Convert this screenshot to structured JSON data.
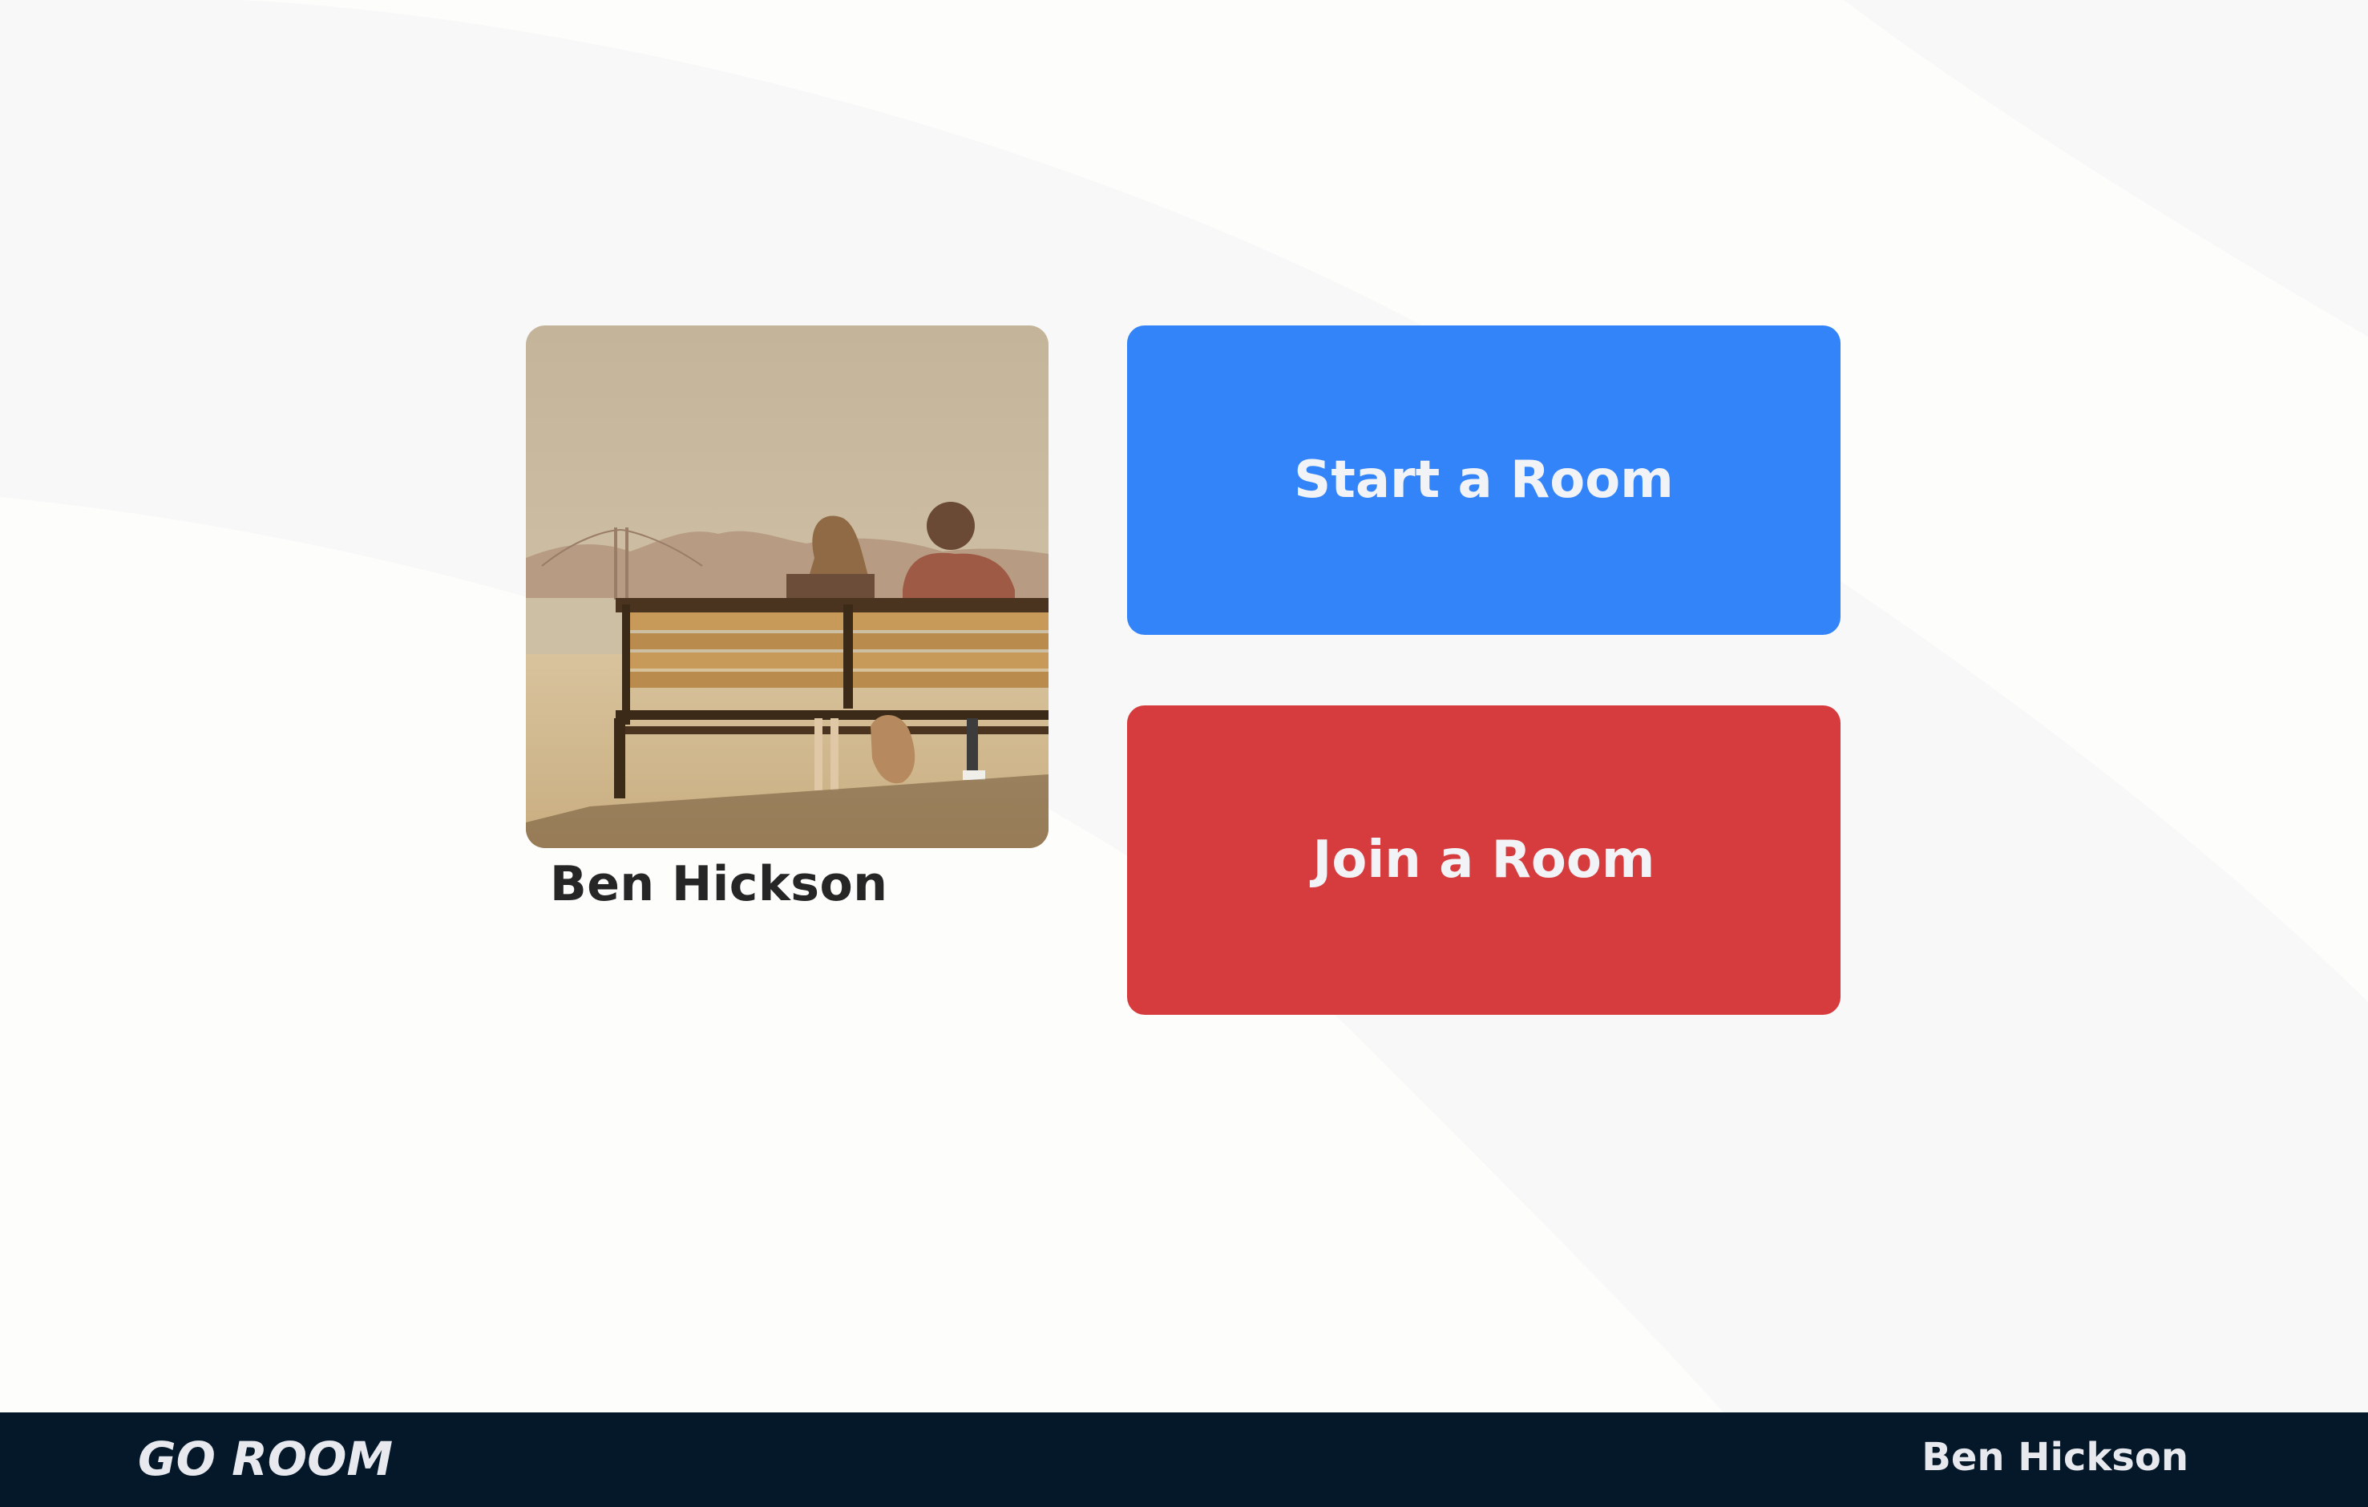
{
  "app": {
    "brand": "GO ROOM"
  },
  "profile": {
    "name": "Ben Hickson",
    "photo_description": "couple-on-bench-photo"
  },
  "actions": {
    "start_label": "Start a Room",
    "join_label": "Join a Room"
  },
  "footer": {
    "user_name": "Ben Hickson"
  },
  "colors": {
    "start_button": "#3284f8",
    "join_button": "#d63c3e",
    "footer_bar": "#04182a",
    "page_background": "#fdfdfc"
  }
}
